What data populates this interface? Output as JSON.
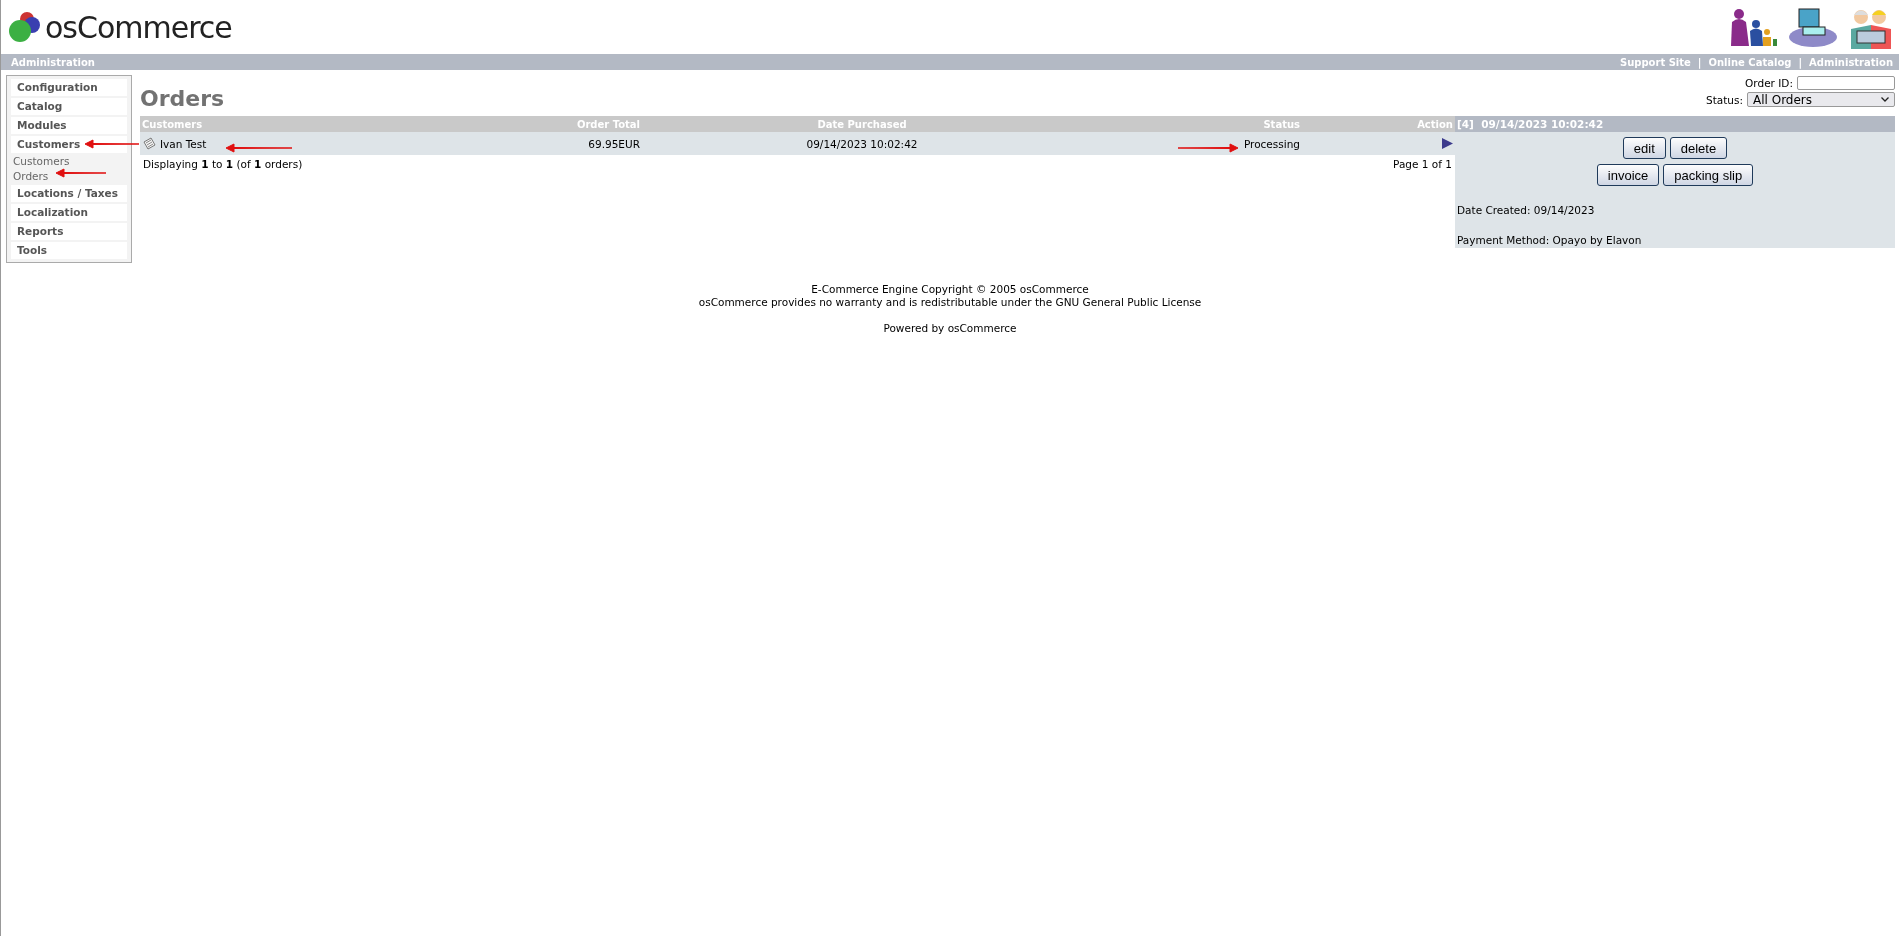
{
  "header": {
    "logo_text": "osCommerce",
    "bar_title": "Administration",
    "links": [
      "Support Site",
      "Online Catalog",
      "Administration"
    ],
    "separator": "|"
  },
  "sidebar": {
    "items": [
      {
        "label": "Configuration"
      },
      {
        "label": "Catalog"
      },
      {
        "label": "Modules"
      },
      {
        "label": "Customers",
        "children": [
          {
            "label": "Customers"
          },
          {
            "label": "Orders"
          }
        ]
      },
      {
        "label": "Locations / Taxes"
      },
      {
        "label": "Localization"
      },
      {
        "label": "Reports"
      },
      {
        "label": "Tools"
      }
    ]
  },
  "page": {
    "title": "Orders",
    "order_id": {
      "label": "Order ID:"
    },
    "status_filter": {
      "label": "Status:",
      "value": "All Orders"
    }
  },
  "table": {
    "columns": [
      "Customers",
      "Order Total",
      "Date Purchased",
      "Status",
      "Action"
    ],
    "rows": [
      {
        "customer": "Ivan Test",
        "total": "69.95EUR",
        "date": "09/14/2023 10:02:42",
        "status": "Processing",
        "selected": true
      }
    ],
    "summary": "Displaying **1** to **1** (of **1** orders)",
    "pages": "Page 1 of 1"
  },
  "details": {
    "title": "[4]  09/14/2023 10:02:42",
    "buttons": [
      [
        "edit",
        "delete"
      ],
      [
        "invoice",
        "packing slip"
      ]
    ],
    "lines": [
      "Date Created: 09/14/2023",
      "Payment Method: Opayo by Elavon"
    ]
  },
  "footer": {
    "lines": [
      "E-Commerce Engine Copyright © 2005 osCommerce",
      "osCommerce provides no warranty and is redistributable under the GNU General Public License"
    ],
    "powered": "Powered by osCommerce"
  },
  "annotation_arrows": [
    {
      "kind": "left"
    },
    {
      "kind": "left"
    },
    {
      "kind": "left"
    },
    {
      "kind": "right"
    }
  ]
}
